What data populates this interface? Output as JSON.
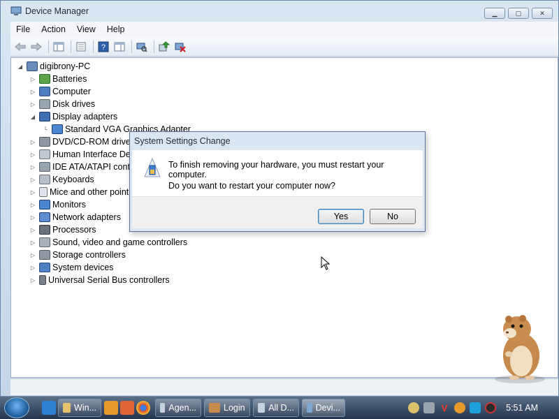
{
  "window": {
    "title": "Device Manager",
    "controls": [
      "minimize",
      "maximize",
      "close"
    ]
  },
  "menubar": {
    "items": [
      "File",
      "Action",
      "View",
      "Help"
    ]
  },
  "toolbar": {
    "icons": [
      "back-icon",
      "forward-icon",
      "show-hide-tree-icon",
      "properties-icon",
      "help-icon",
      "action-pane-icon",
      "scan-hardware-icon",
      "update-driver-icon",
      "uninstall-icon"
    ]
  },
  "tree": {
    "root": "digibrony-PC",
    "items": [
      {
        "label": "Batteries",
        "icon": "battery-icon"
      },
      {
        "label": "Computer",
        "icon": "computer-icon"
      },
      {
        "label": "Disk drives",
        "icon": "disk-drive-icon"
      },
      {
        "label": "Display adapters",
        "icon": "display-adapter-icon",
        "expanded": true
      },
      {
        "label": "Standard VGA Graphics Adapter",
        "icon": "monitor-icon",
        "child": true
      },
      {
        "label": "DVD/CD-ROM drives",
        "icon": "dvd-icon"
      },
      {
        "label": "Human Interface Dev",
        "icon": "hid-icon"
      },
      {
        "label": "IDE ATA/ATAPI cont",
        "icon": "ide-icon"
      },
      {
        "label": "Keyboards",
        "icon": "keyboard-icon"
      },
      {
        "label": "Mice and other point",
        "icon": "mouse-icon"
      },
      {
        "label": "Monitors",
        "icon": "monitor-icon"
      },
      {
        "label": "Network adapters",
        "icon": "network-icon"
      },
      {
        "label": "Processors",
        "icon": "processor-icon"
      },
      {
        "label": "Sound, video and game controllers",
        "icon": "sound-icon"
      },
      {
        "label": "Storage controllers",
        "icon": "storage-icon"
      },
      {
        "label": "System devices",
        "icon": "system-devices-icon"
      },
      {
        "label": "Universal Serial Bus controllers",
        "icon": "usb-icon"
      }
    ]
  },
  "dialog": {
    "title": "System Settings Change",
    "message": "To finish removing your hardware, you must restart your computer.",
    "question": "Do you want to restart your computer now?",
    "yes_label": "Yes",
    "no_label": "No"
  },
  "taskbar": {
    "quick_launch": [
      "ie-icon",
      "media-player-icon",
      "paint-icon",
      "chrome-icon"
    ],
    "tasks": [
      "Win...",
      "Agen...",
      "Login",
      "All D...",
      "Devi..."
    ],
    "clock": "5:51 AM"
  },
  "colors": {
    "accent": "#1d5d9b",
    "window_frame": "#c6d5e7",
    "taskbar": "#24344c"
  }
}
